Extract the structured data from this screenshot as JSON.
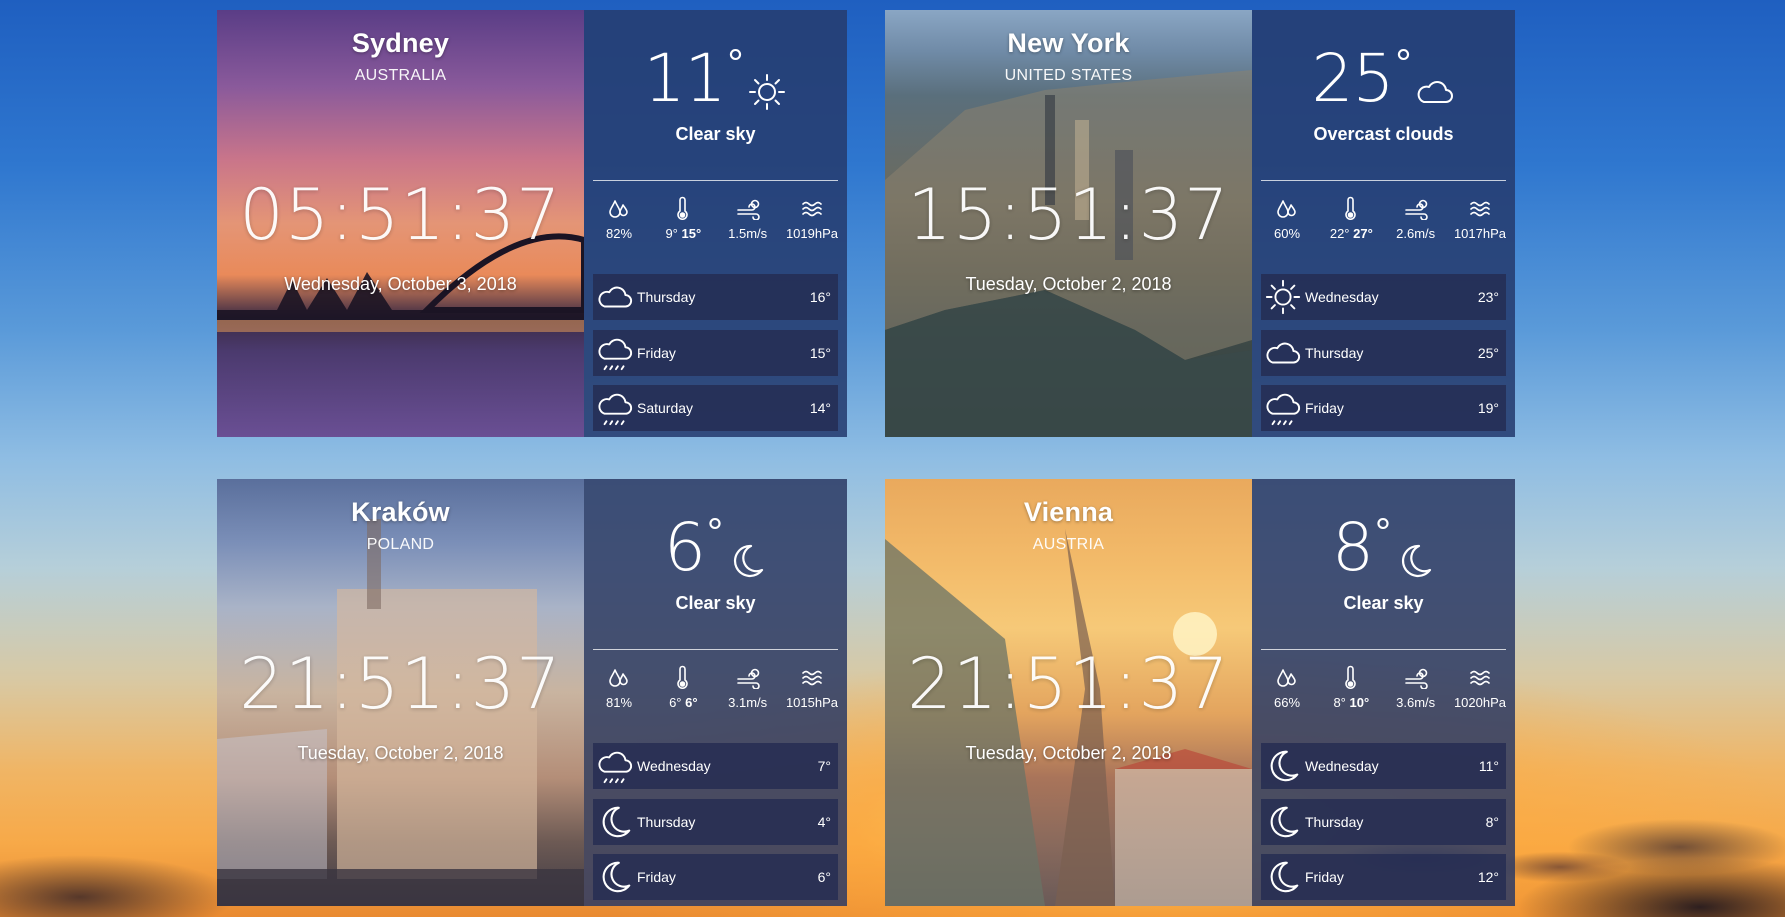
{
  "cards": [
    {
      "city": "Sydney",
      "country": "AUSTRALIA",
      "time": "05:51:37",
      "date": "Wednesday, October 3, 2018",
      "temp": "11",
      "deg": "°",
      "condition": "Clear sky",
      "condition_icon": "sun-icon",
      "humidity": "82%",
      "temp_min": "9°",
      "temp_max": "15°",
      "wind": "1.5m/s",
      "pressure": "1019hPa",
      "forecast": [
        {
          "day": "Thursday",
          "temp": "16°",
          "icon": "cloud-icon"
        },
        {
          "day": "Friday",
          "temp": "15°",
          "icon": "rain-cloud-icon"
        },
        {
          "day": "Saturday",
          "temp": "14°",
          "icon": "rain-cloud-icon"
        }
      ]
    },
    {
      "city": "New York",
      "country": "UNITED STATES",
      "time": "15:51:37",
      "date": "Tuesday, October 2, 2018",
      "temp": "25",
      "deg": "°",
      "condition": "Overcast clouds",
      "condition_icon": "cloud-icon",
      "humidity": "60%",
      "temp_min": "22°",
      "temp_max": "27°",
      "wind": "2.6m/s",
      "pressure": "1017hPa",
      "forecast": [
        {
          "day": "Wednesday",
          "temp": "23°",
          "icon": "sun-icon"
        },
        {
          "day": "Thursday",
          "temp": "25°",
          "icon": "cloud-icon"
        },
        {
          "day": "Friday",
          "temp": "19°",
          "icon": "rain-cloud-icon"
        }
      ]
    },
    {
      "city": "Kraków",
      "country": "POLAND",
      "time": "21:51:37",
      "date": "Tuesday, October 2, 2018",
      "temp": "6",
      "deg": "°",
      "condition": "Clear sky",
      "condition_icon": "moon-icon",
      "humidity": "81%",
      "temp_min": "6°",
      "temp_max": "6°",
      "wind": "3.1m/s",
      "pressure": "1015hPa",
      "forecast": [
        {
          "day": "Wednesday",
          "temp": "7°",
          "icon": "rain-cloud-icon"
        },
        {
          "day": "Thursday",
          "temp": "4°",
          "icon": "moon-icon"
        },
        {
          "day": "Friday",
          "temp": "6°",
          "icon": "moon-icon"
        }
      ]
    },
    {
      "city": "Vienna",
      "country": "AUSTRIA",
      "time": "21:51:37",
      "date": "Tuesday, October 2, 2018",
      "temp": "8",
      "deg": "°",
      "condition": "Clear sky",
      "condition_icon": "moon-icon",
      "humidity": "66%",
      "temp_min": "8°",
      "temp_max": "10°",
      "wind": "3.6m/s",
      "pressure": "1020hPa",
      "forecast": [
        {
          "day": "Wednesday",
          "temp": "11°",
          "icon": "moon-icon"
        },
        {
          "day": "Thursday",
          "temp": "8°",
          "icon": "moon-icon"
        },
        {
          "day": "Friday",
          "temp": "12°",
          "icon": "moon-icon"
        }
      ]
    }
  ]
}
